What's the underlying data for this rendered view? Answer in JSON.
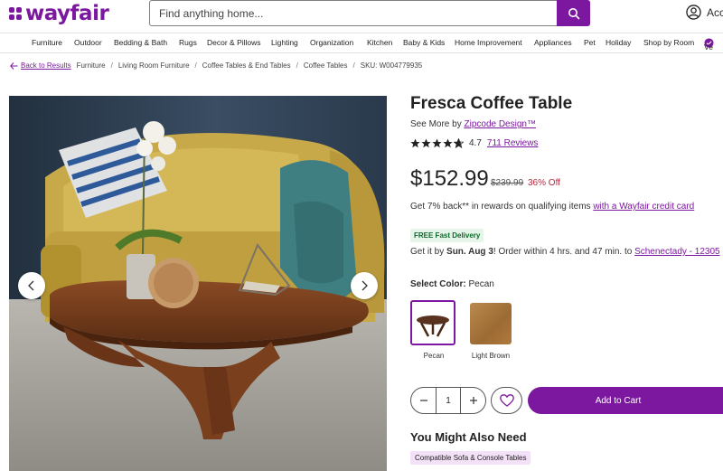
{
  "brand": {
    "name": "wayfair",
    "color": "#7b189f"
  },
  "search": {
    "placeholder": "Find anything home..."
  },
  "account": {
    "label": "Account"
  },
  "nav": {
    "items": [
      "Furniture",
      "Outdoor",
      "Bedding & Bath",
      "Rugs",
      "Decor & Pillows",
      "Lighting",
      "Organization",
      "Kitchen",
      "Baby & Kids",
      "Home Improvement",
      "Appliances",
      "Pet",
      "Holiday",
      "Shop by Room",
      "Ve"
    ]
  },
  "breadcrumb": {
    "back": "Back to Results",
    "items": [
      "Furniture",
      "Living Room Furniture",
      "Coffee Tables & End Tables",
      "Coffee Tables"
    ],
    "sku": "SKU: W004779935"
  },
  "product": {
    "title": "Fresca Coffee Table",
    "see_more_prefix": "See More by",
    "brand": "Zipcode Design™",
    "rating": "4.7",
    "rating_value": 4.7,
    "reviews": "711 Reviews",
    "price": "$152.99",
    "was_price": "$239.99",
    "discount": "36% Off",
    "rewards_text": "Get 7% back** in rewards on qualifying items",
    "rewards_link": "with a Wayfair credit card",
    "shipping_badge": "FREE Fast Delivery",
    "delivery_prefix": "Get it by",
    "delivery_date": "Sun. Aug 3",
    "delivery_suffix": "! Order within 4 hrs. and 47 min. to",
    "delivery_location": "Schenectady - 12305",
    "color_label": "Select Color:",
    "selected_color": "Pecan",
    "swatches": [
      {
        "label": "Pecan",
        "color": "#6b3b22"
      },
      {
        "label": "Light Brown",
        "color": "#b07a3e"
      }
    ],
    "quantity": "1",
    "add_to_cart": "Add to Cart"
  },
  "also_need": {
    "heading": "You Might Also Need",
    "chip": "Compatible Sofa & Console Tables"
  }
}
